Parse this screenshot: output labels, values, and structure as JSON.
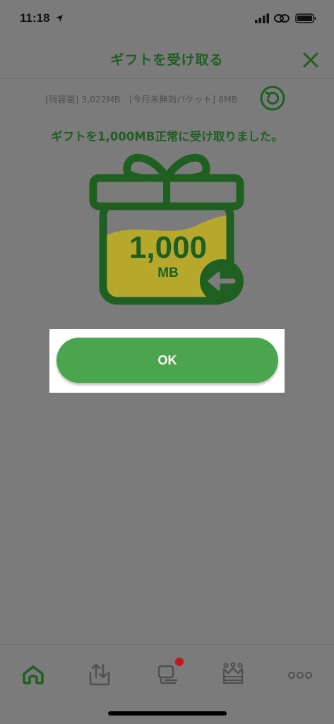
{
  "status_bar": {
    "time": "11:18",
    "icons": [
      "location-arrow-icon",
      "signal-icon",
      "link-icon",
      "battery-icon"
    ]
  },
  "header": {
    "title": "ギフトを受け取る",
    "close_icon": "close-icon"
  },
  "capacity": {
    "text": "[残容量] 3,022MB　[今月未無効パケット] 8MB",
    "refresh_icon": "refresh-icon"
  },
  "message": "ギフトを1,000MB正常に受け取りました。",
  "gift": {
    "amount": "1,000",
    "unit": "MB",
    "fill_fraction": 0.5,
    "arrow_icon": "arrow-left-icon"
  },
  "ok_button": {
    "label": "OK"
  },
  "tab_bar": {
    "tabs": [
      {
        "icon": "home-icon",
        "active": true
      },
      {
        "icon": "data-transfer-icon",
        "active": false
      },
      {
        "icon": "chat-icon",
        "active": false,
        "badge": true
      },
      {
        "icon": "crown-icon",
        "active": false
      },
      {
        "icon": "more-icon",
        "active": false
      }
    ]
  },
  "colors": {
    "overlay": "#7b7b7b",
    "brand_green": "#1f5f22",
    "button_green": "#4aa54e",
    "gift_fill": "#b5a82c",
    "badge_red": "#c0161e"
  }
}
